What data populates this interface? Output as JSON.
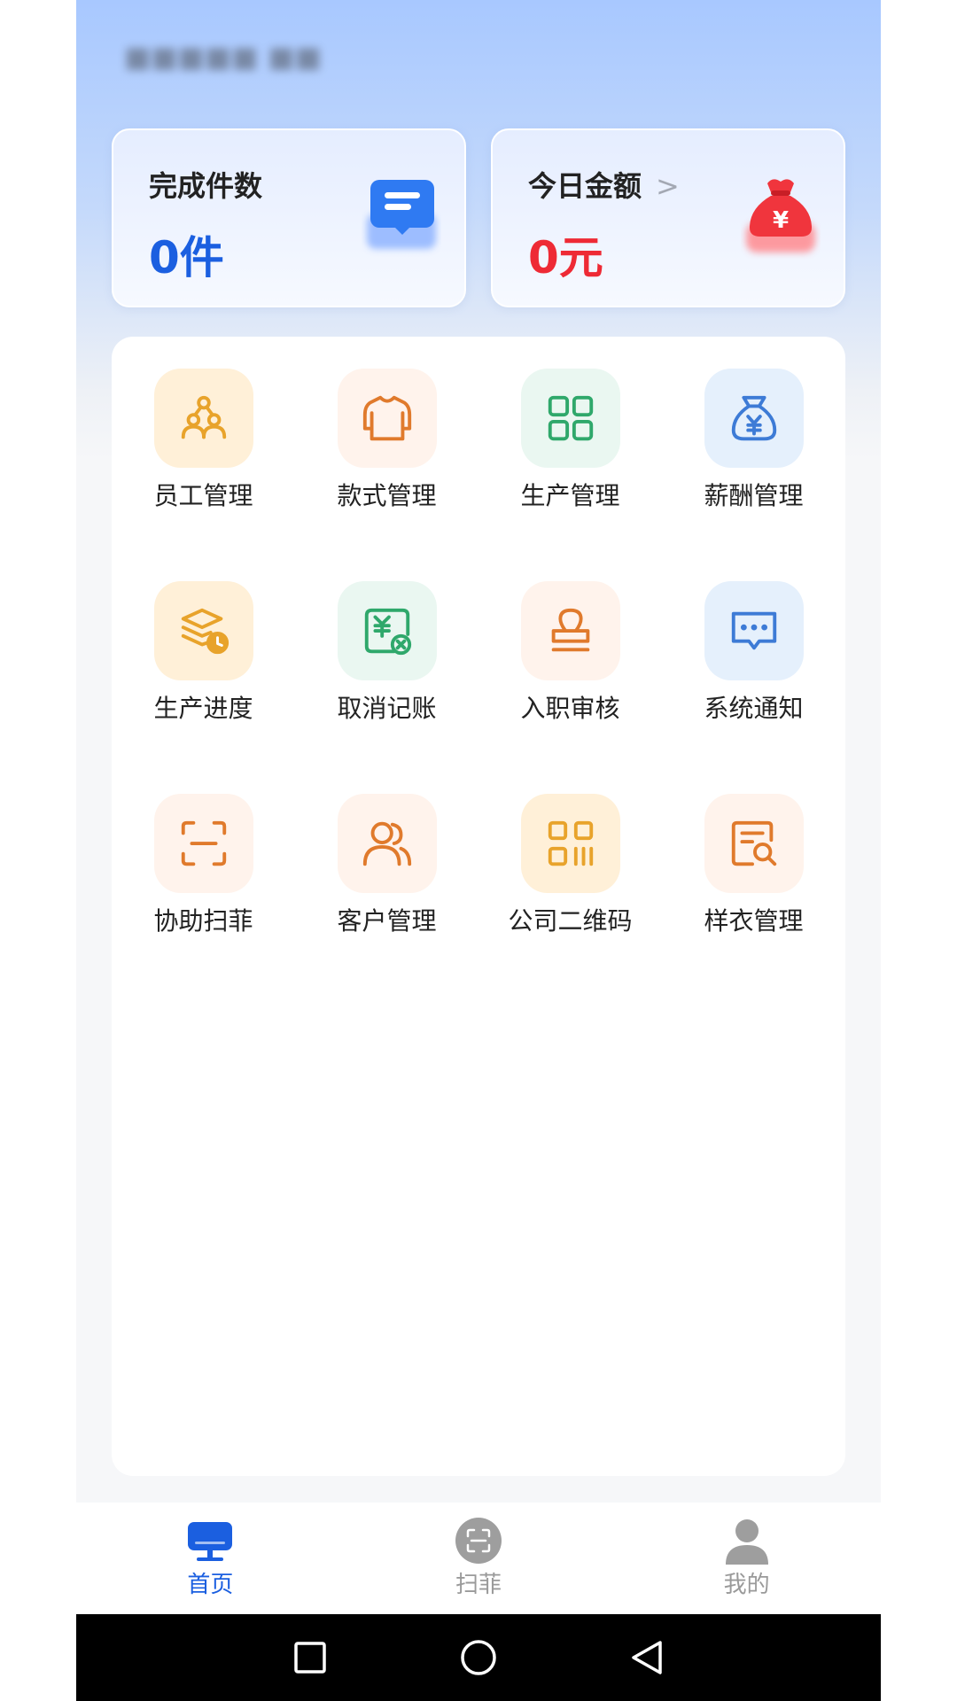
{
  "header": {
    "company_name": "■■■■■ ■■"
  },
  "stats": {
    "completed": {
      "label": "完成件数",
      "value": "0件"
    },
    "today_amount": {
      "label": "今日金额",
      "value": "0元"
    }
  },
  "menu": {
    "items": [
      {
        "label": "员工管理",
        "icon": "staff-group-icon"
      },
      {
        "label": "款式管理",
        "icon": "garment-sweater-icon"
      },
      {
        "label": "生产管理",
        "icon": "grid-apps-icon"
      },
      {
        "label": "薪酬管理",
        "icon": "money-bag-icon"
      },
      {
        "label": "生产进度",
        "icon": "layers-clock-icon"
      },
      {
        "label": "取消记账",
        "icon": "cancel-bill-icon"
      },
      {
        "label": "入职审核",
        "icon": "stamp-icon"
      },
      {
        "label": "系统通知",
        "icon": "message-bubble-icon"
      },
      {
        "label": "协助扫菲",
        "icon": "scan-frame-icon"
      },
      {
        "label": "客户管理",
        "icon": "customers-icon"
      },
      {
        "label": "公司二维码",
        "icon": "qr-code-icon"
      },
      {
        "label": "样衣管理",
        "icon": "document-search-icon"
      }
    ]
  },
  "tabbar": {
    "items": [
      {
        "label": "首页",
        "icon": "monitor-icon",
        "active": true
      },
      {
        "label": "扫菲",
        "icon": "scan-icon",
        "active": false
      },
      {
        "label": "我的",
        "icon": "user-icon",
        "active": false
      }
    ]
  },
  "colors": {
    "accent": "#1b5fe0",
    "red": "#ee2a35",
    "orange": "#e07a2c",
    "gold": "#e8a32b",
    "green": "#2fa86b",
    "blue": "#3d7bd6"
  }
}
